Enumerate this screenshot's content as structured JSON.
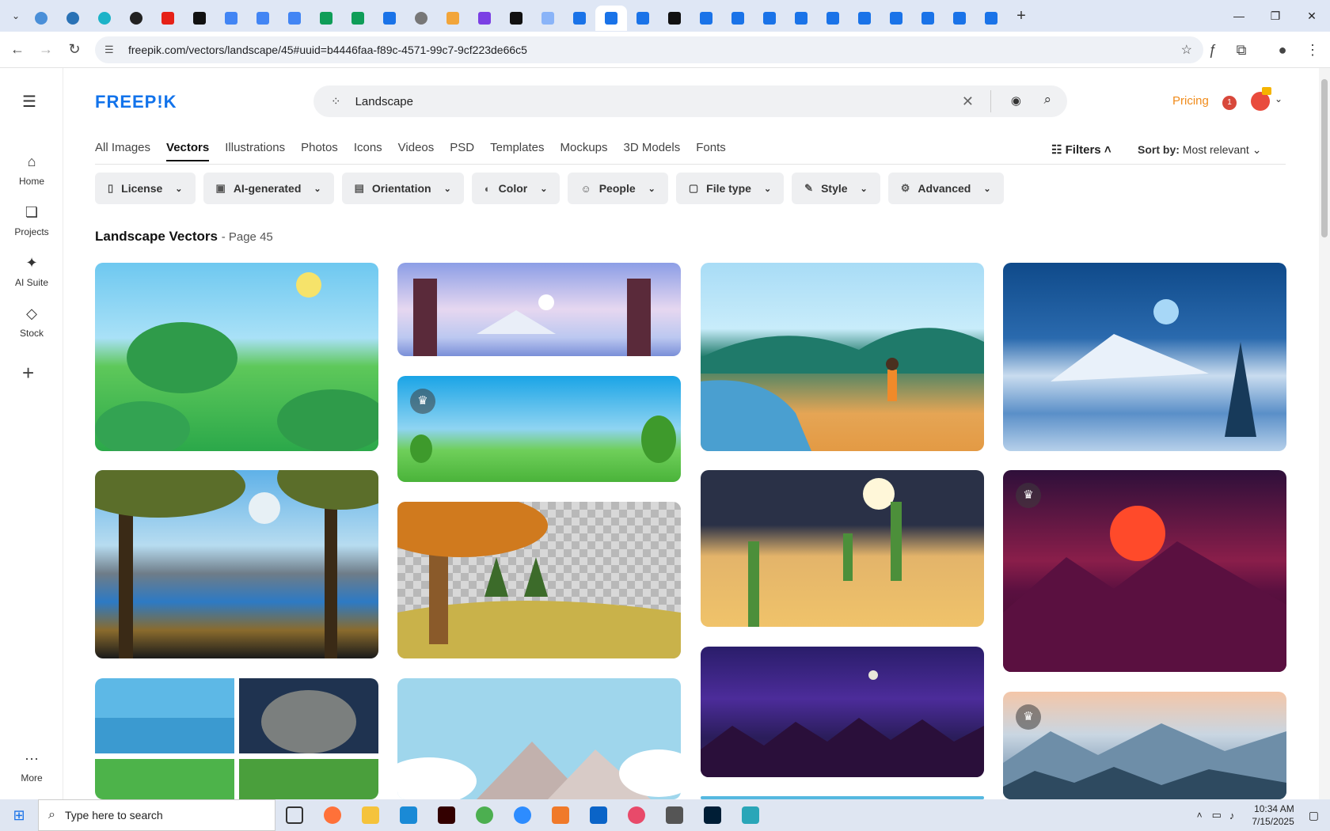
{
  "browser": {
    "url": "freepik.com/vectors/landscape/45#uuid=b4446faa-f89c-4571-99c7-9cf223de66c5",
    "tab_count": 32
  },
  "sidebar": {
    "items": [
      {
        "label": "Home",
        "icon": "home-icon"
      },
      {
        "label": "Projects",
        "icon": "projects-icon"
      },
      {
        "label": "AI Suite",
        "icon": "sparkle-icon"
      },
      {
        "label": "Stock",
        "icon": "stock-icon"
      }
    ],
    "more_label": "More"
  },
  "header": {
    "logo": "FREEP!K",
    "search_value": "Landscape",
    "pricing_label": "Pricing",
    "notification_count": "1"
  },
  "nav": {
    "tabs": [
      "All Images",
      "Vectors",
      "Illustrations",
      "Photos",
      "Icons",
      "Videos",
      "PSD",
      "Templates",
      "Mockups",
      "3D Models",
      "Fonts"
    ],
    "active": "Vectors",
    "filters_label": "Filters",
    "sort_label": "Sort by:",
    "sort_value": "Most relevant"
  },
  "chips": [
    "License",
    "AI-generated",
    "Orientation",
    "Color",
    "People",
    "File type",
    "Style",
    "Advanced"
  ],
  "results": {
    "title": "Landscape Vectors",
    "page_label": "- Page 45"
  },
  "taskbar": {
    "search_placeholder": "Type here to search",
    "time": "10:34 AM",
    "date": "7/15/2025"
  },
  "colors": {
    "brand": "#1273eb",
    "pricing": "#f08b1a",
    "notification": "#d8483b"
  }
}
